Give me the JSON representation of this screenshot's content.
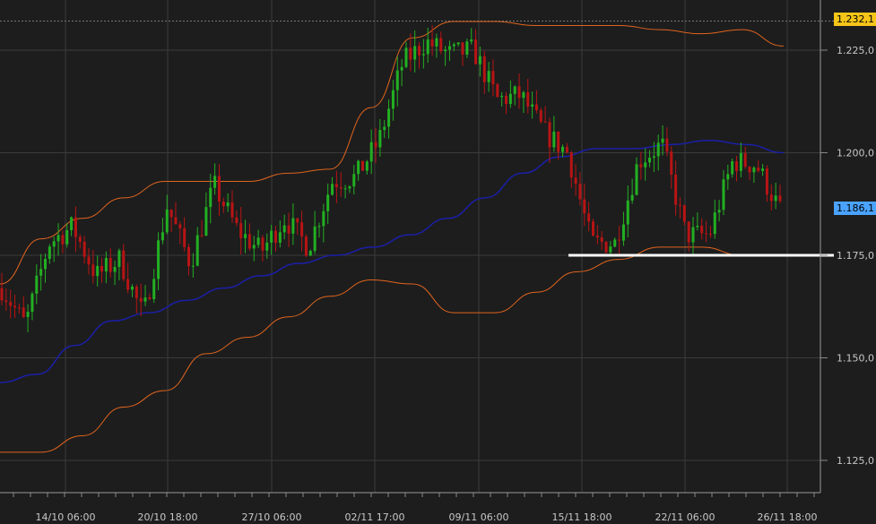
{
  "chart_data": {
    "type": "candlestick",
    "y_axis": {
      "ticks": [
        1.125,
        1.15,
        1.175,
        1.2,
        1.225
      ],
      "tick_labels": [
        "1,125,0",
        "1,150,0",
        "1,175,0",
        "1,200,0",
        "1,225,0"
      ],
      "range": [
        1.115,
        1.235
      ]
    },
    "x_axis": {
      "labels": [
        "14/10 06:00",
        "20/10 18:00",
        "27/10 06:00",
        "02/11 17:00",
        "09/11 06:00",
        "15/11 18:00",
        "22/11 06:00",
        "26/11 18:00"
      ]
    },
    "grid": true,
    "markers": {
      "last_high": {
        "value": 1.2321,
        "label": "1.232,1",
        "color": "#f5c518"
      },
      "current": {
        "value": 1.1861,
        "label": "1.186,1",
        "color": "#4aa3ff"
      },
      "support": {
        "value": 1.175,
        "label": "1.175,0"
      }
    },
    "moving_average": [
      1.144,
      1.146,
      1.153,
      1.159,
      1.161,
      1.164,
      1.167,
      1.17,
      1.173,
      1.175,
      1.177,
      1.18,
      1.184,
      1.189,
      1.195,
      1.199,
      1.201,
      1.201,
      1.202,
      1.203,
      1.202,
      1.2
    ],
    "upper_band": [
      1.168,
      1.179,
      1.184,
      1.189,
      1.193,
      1.193,
      1.193,
      1.195,
      1.196,
      1.211,
      1.228,
      1.232,
      1.232,
      1.231,
      1.231,
      1.231,
      1.23,
      1.229,
      1.23,
      1.226
    ],
    "lower_band": [
      1.127,
      1.127,
      1.131,
      1.138,
      1.142,
      1.151,
      1.155,
      1.16,
      1.165,
      1.169,
      1.168,
      1.161,
      1.161,
      1.166,
      1.171,
      1.174,
      1.177,
      1.177,
      1.175,
      1.175
    ],
    "colors": {
      "up": "#22b022",
      "down": "#b81414",
      "band": "#e0641e",
      "ma": "#1b1fa8",
      "support": "#ffffff"
    },
    "candles": {
      "pivots": [
        1.167,
        1.158,
        1.178,
        1.182,
        1.17,
        1.174,
        1.16,
        1.187,
        1.173,
        1.192,
        1.181,
        1.176,
        1.184,
        1.177,
        1.193,
        1.194,
        1.203,
        1.222,
        1.227,
        1.224,
        1.225,
        1.213,
        1.214,
        1.205,
        1.2,
        1.178,
        1.178,
        1.198,
        1.202,
        1.18,
        1.18,
        1.198,
        1.197,
        1.186
      ],
      "count": 180
    }
  }
}
